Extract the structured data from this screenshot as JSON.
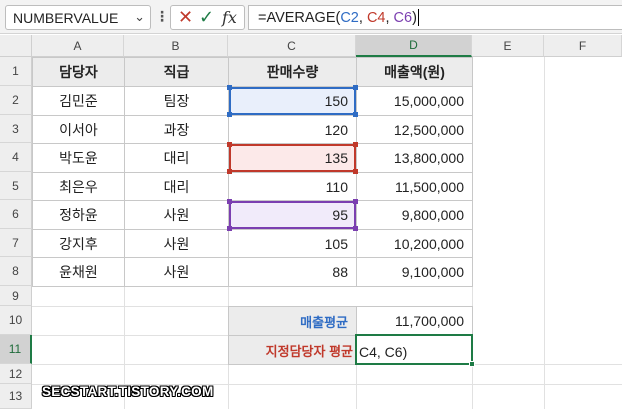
{
  "formula_bar": {
    "name_box": "NUMBERVALUE",
    "name_box_chevron": "⌄",
    "more_dots": "⋮",
    "cancel_glyph": "✕",
    "enter_glyph": "✓",
    "fx_label": "fx",
    "formula_parts": [
      "=AVERAGE(",
      "C2",
      ", ",
      "C4",
      ", ",
      "C6",
      ")"
    ]
  },
  "columns": [
    "A",
    "B",
    "C",
    "D",
    "E",
    "F"
  ],
  "selected_column": "D",
  "rows": [
    "1",
    "2",
    "3",
    "4",
    "5",
    "6",
    "7",
    "8",
    "9",
    "10",
    "11",
    "12",
    "13"
  ],
  "selected_row": "11",
  "table": {
    "headers": [
      "담당자",
      "직급",
      "판매수량",
      "매출액(원)"
    ],
    "rows": [
      [
        "김민준",
        "팀장",
        "150",
        "15,000,000"
      ],
      [
        "이서아",
        "과장",
        "120",
        "12,500,000"
      ],
      [
        "박도윤",
        "대리",
        "135",
        "13,800,000"
      ],
      [
        "최은우",
        "대리",
        "110",
        "11,500,000"
      ],
      [
        "정하윤",
        "사원",
        "95",
        "9,800,000"
      ],
      [
        "강지후",
        "사원",
        "105",
        "10,200,000"
      ],
      [
        "윤채원",
        "사원",
        "88",
        "9,100,000"
      ]
    ]
  },
  "summary": {
    "avg_label": "매출평균",
    "avg_value": "11,700,000",
    "designated_label": "지정담당자 평균",
    "editing_text": "C4, C6)"
  },
  "colors": {
    "ref_blue": "#2f6cc4",
    "ref_red": "#c0392b",
    "ref_purple": "#7b3fb0",
    "active_green": "#1e7b45"
  },
  "watermark": "SECSTART.TISTORY.COM"
}
